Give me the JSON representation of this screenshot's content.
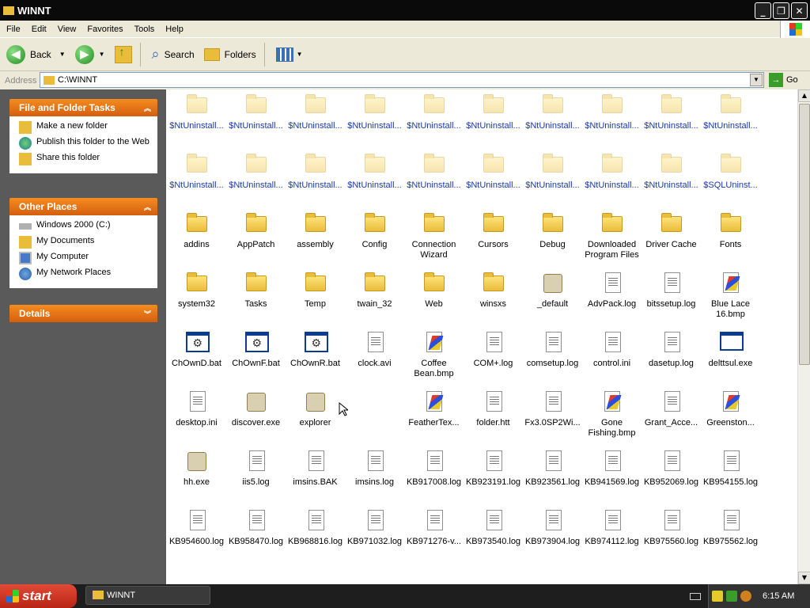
{
  "window": {
    "title": "WINNT",
    "minimize": "_",
    "maximize": "❐",
    "close": "✕"
  },
  "menu": [
    "File",
    "Edit",
    "View",
    "Favorites",
    "Tools",
    "Help"
  ],
  "toolbar": {
    "back": "Back",
    "search": "Search",
    "folders": "Folders"
  },
  "address": {
    "label": "Address",
    "value": "C:\\WINNT",
    "go": "Go"
  },
  "sidebar": {
    "tasks": {
      "title": "File and Folder Tasks",
      "items": [
        "Make a new folder",
        "Publish this folder to the Web",
        "Share this folder"
      ]
    },
    "places": {
      "title": "Other Places",
      "items": [
        "Windows 2000 (C:)",
        "My Documents",
        "My Computer",
        "My Network Places"
      ]
    },
    "details": {
      "title": "Details"
    }
  },
  "files": [
    {
      "name": "$NtUninstall...",
      "type": "folder-hidden"
    },
    {
      "name": "$NtUninstall...",
      "type": "folder-hidden"
    },
    {
      "name": "$NtUninstall...",
      "type": "folder-hidden"
    },
    {
      "name": "$NtUninstall...",
      "type": "folder-hidden"
    },
    {
      "name": "$NtUninstall...",
      "type": "folder-hidden"
    },
    {
      "name": "$NtUninstall...",
      "type": "folder-hidden"
    },
    {
      "name": "$NtUninstall...",
      "type": "folder-hidden"
    },
    {
      "name": "$NtUninstall...",
      "type": "folder-hidden"
    },
    {
      "name": "$NtUninstall...",
      "type": "folder-hidden"
    },
    {
      "name": "$NtUninstall...",
      "type": "folder-hidden"
    },
    {
      "name": "$NtUninstall...",
      "type": "folder-hidden"
    },
    {
      "name": "$NtUninstall...",
      "type": "folder-hidden"
    },
    {
      "name": "$NtUninstall...",
      "type": "folder-hidden"
    },
    {
      "name": "$NtUninstall...",
      "type": "folder-hidden"
    },
    {
      "name": "$NtUninstall...",
      "type": "folder-hidden"
    },
    {
      "name": "$NtUninstall...",
      "type": "folder-hidden"
    },
    {
      "name": "$NtUninstall...",
      "type": "folder-hidden"
    },
    {
      "name": "$NtUninstall...",
      "type": "folder-hidden"
    },
    {
      "name": "$NtUninstall...",
      "type": "folder-hidden"
    },
    {
      "name": "$SQLUninst...",
      "type": "folder-hidden"
    },
    {
      "name": "addins",
      "type": "folder"
    },
    {
      "name": "AppPatch",
      "type": "folder"
    },
    {
      "name": "assembly",
      "type": "folder"
    },
    {
      "name": "Config",
      "type": "folder"
    },
    {
      "name": "Connection Wizard",
      "type": "folder"
    },
    {
      "name": "Cursors",
      "type": "folder"
    },
    {
      "name": "Debug",
      "type": "folder"
    },
    {
      "name": "Downloaded Program Files",
      "type": "folder"
    },
    {
      "name": "Driver Cache",
      "type": "folder"
    },
    {
      "name": "Fonts",
      "type": "folder"
    },
    {
      "name": "system32",
      "type": "folder"
    },
    {
      "name": "Tasks",
      "type": "folder"
    },
    {
      "name": "Temp",
      "type": "folder"
    },
    {
      "name": "twain_32",
      "type": "folder"
    },
    {
      "name": "Web",
      "type": "folder"
    },
    {
      "name": "winsxs",
      "type": "folder"
    },
    {
      "name": "_default",
      "type": "gen"
    },
    {
      "name": "AdvPack.log",
      "type": "doc"
    },
    {
      "name": "bitssetup.log",
      "type": "doc"
    },
    {
      "name": "Blue Lace 16.bmp",
      "type": "bmp"
    },
    {
      "name": "ChOwnD.bat",
      "type": "bat"
    },
    {
      "name": "ChOwnF.bat",
      "type": "bat"
    },
    {
      "name": "ChOwnR.bat",
      "type": "bat"
    },
    {
      "name": "clock.avi",
      "type": "doc"
    },
    {
      "name": "Coffee Bean.bmp",
      "type": "bmp"
    },
    {
      "name": "COM+.log",
      "type": "doc"
    },
    {
      "name": "comsetup.log",
      "type": "doc"
    },
    {
      "name": "control.ini",
      "type": "doc"
    },
    {
      "name": "dasetup.log",
      "type": "doc"
    },
    {
      "name": "delttsul.exe",
      "type": "exe"
    },
    {
      "name": "desktop.ini",
      "type": "doc"
    },
    {
      "name": "discover.exe",
      "type": "gen"
    },
    {
      "name": "explorer",
      "type": "gen"
    },
    {
      "name": "",
      "type": "empty"
    },
    {
      "name": "FeatherTex...",
      "type": "bmp"
    },
    {
      "name": "folder.htt",
      "type": "doc"
    },
    {
      "name": "Fx3.0SP2Wi...",
      "type": "doc"
    },
    {
      "name": "Gone Fishing.bmp",
      "type": "bmp"
    },
    {
      "name": "Grant_Acce...",
      "type": "doc"
    },
    {
      "name": "Greenston...",
      "type": "bmp"
    },
    {
      "name": "hh.exe",
      "type": "gen"
    },
    {
      "name": "iis5.log",
      "type": "doc"
    },
    {
      "name": "imsins.BAK",
      "type": "doc"
    },
    {
      "name": "imsins.log",
      "type": "doc"
    },
    {
      "name": "KB917008.log",
      "type": "doc"
    },
    {
      "name": "KB923191.log",
      "type": "doc"
    },
    {
      "name": "KB923561.log",
      "type": "doc"
    },
    {
      "name": "KB941569.log",
      "type": "doc"
    },
    {
      "name": "KB952069.log",
      "type": "doc"
    },
    {
      "name": "KB954155.log",
      "type": "doc"
    },
    {
      "name": "KB954600.log",
      "type": "doc"
    },
    {
      "name": "KB958470.log",
      "type": "doc"
    },
    {
      "name": "KB968816.log",
      "type": "doc"
    },
    {
      "name": "KB971032.log",
      "type": "doc"
    },
    {
      "name": "KB971276-v...",
      "type": "doc"
    },
    {
      "name": "KB973540.log",
      "type": "doc"
    },
    {
      "name": "KB973904.log",
      "type": "doc"
    },
    {
      "name": "KB974112.log",
      "type": "doc"
    },
    {
      "name": "KB975560.log",
      "type": "doc"
    },
    {
      "name": "KB975562.log",
      "type": "doc"
    }
  ],
  "taskbar": {
    "start": "start",
    "task": "WINNT",
    "clock": "6:15 AM"
  }
}
